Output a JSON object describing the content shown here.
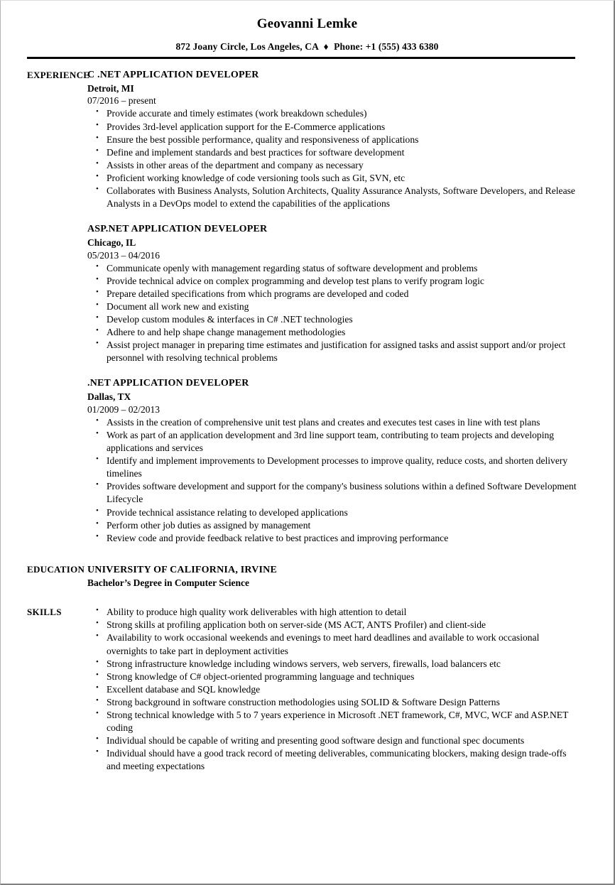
{
  "document": {
    "type": "resume",
    "page_border_color": "#808080"
  },
  "header": {
    "name": "Geovanni Lemke",
    "address": "872 Joany Circle, Los Angeles, CA",
    "separator": "♦",
    "phone": "Phone: +1 (555) 433 6380"
  },
  "sections": {
    "experience_label": "EXPERIENCE",
    "education_label": "EDUCATION",
    "skills_label": "SKILLS"
  },
  "experience": [
    {
      "title": "C .NET APPLICATION DEVELOPER",
      "location": "Detroit, MI",
      "dates": "07/2016 – present",
      "bullets": [
        "Provide accurate and timely estimates (work breakdown schedules)",
        "Provides 3rd-level application support for the E-Commerce applications",
        "Ensure the best possible performance, quality and responsiveness of applications",
        "Define and implement standards and best practices for software development",
        "Assists in other areas of the department and company as necessary",
        "Proficient working knowledge of code versioning tools such as Git, SVN, etc",
        "Collaborates with Business Analysts, Solution Architects, Quality Assurance Analysts, Software Developers, and Release Analysts in a DevOps model to extend the capabilities of the applications"
      ]
    },
    {
      "title": "ASP.NET APPLICATION DEVELOPER",
      "location": "Chicago, IL",
      "dates": "05/2013 – 04/2016",
      "bullets": [
        "Communicate openly with management regarding status of software development and problems",
        "Provide technical advice on complex programming and develop test plans to verify program logic",
        "Prepare detailed specifications from which programs are developed and coded",
        "Document all work new and existing",
        "Develop custom modules & interfaces in C# .NET technologies",
        "Adhere to and help shape change management methodologies",
        "Assist project manager in preparing time estimates and justification for assigned tasks and assist support and/or project personnel with resolving technical problems"
      ]
    },
    {
      "title": ".NET APPLICATION DEVELOPER",
      "location": "Dallas, TX",
      "dates": "01/2009 – 02/2013",
      "bullets": [
        "Assists in the creation of comprehensive unit test plans and creates and executes test cases in line with test plans",
        "Work as part of an application development and 3rd line support team, contributing to team projects and developing applications and services",
        "Identify and implement improvements to Development processes to improve quality, reduce costs, and shorten delivery timelines",
        "Provides software development and support for the company's business solutions within a defined Software Development Lifecycle",
        "Provide technical assistance relating to developed applications",
        "Perform other job duties as assigned by management",
        "Review code and provide feedback relative to best practices and improving performance"
      ]
    }
  ],
  "education": {
    "school": "UNIVERSITY OF CALIFORNIA, IRVINE",
    "degree": "Bachelor’s Degree in Computer Science"
  },
  "skills": [
    "Ability to produce high quality work deliverables with high attention to detail",
    "Strong skills at profiling application both on server-side (MS ACT, ANTS Profiler) and client-side",
    "Availability to work occasional weekends and evenings to meet hard deadlines and available to work occasional overnights to take part in deployment activities",
    "Strong infrastructure knowledge including windows servers, web servers, firewalls, load balancers etc",
    "Strong knowledge of C# object-oriented programming language and techniques",
    "Excellent database and SQL knowledge",
    "Strong background in software construction methodologies using SOLID & Software Design Patterns",
    "Strong technical knowledge with 5 to 7 years experience in Microsoft .NET framework, C#, MVC, WCF and ASP.NET coding",
    "Individual should be capable of writing and presenting good software design and functional spec documents",
    "Individual should have a good track record of meeting deliverables, communicating blockers, making design trade-offs and meeting expectations"
  ]
}
